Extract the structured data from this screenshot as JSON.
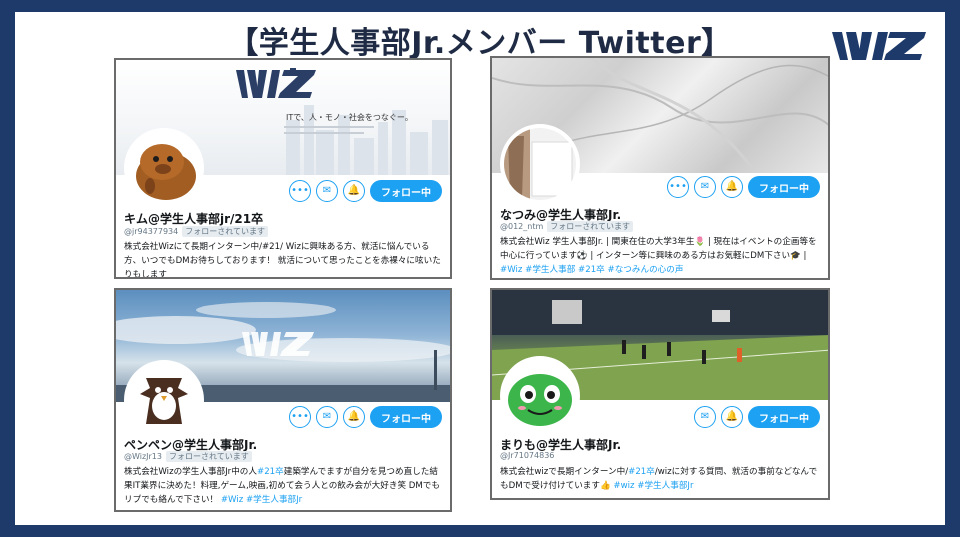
{
  "title": {
    "prefix": "【学生人事部Jr.メンバー ",
    "twitter": "Twitter",
    "suffix": "】"
  },
  "follow_label": "フォロー中",
  "follows_you_label": "フォローされています",
  "banner_tagline": "ITで、人・モノ・社会をつなぐー。",
  "cards": [
    {
      "name": "キム@学生人事部jr/21卒",
      "handle": "@jr94377934",
      "bio_1": "株式会社Wizにて長期インターン中/#21/ Wizに興味ある方、就活に悩んでいる方、いつでもDMお待ちしております！",
      "bio_2": "就活について思ったことを赤裸々に呟いたりもします"
    },
    {
      "name": "なつみ@学生人事部Jr.",
      "handle": "@012_ntm",
      "bio": "株式会社Wiz 学生人事部Jr. | 関東在住の大学3年生🌷 | 現在はイベントの企画等を中心に行っています⚽ | インターン等に興味のある方はお気軽にDM下さい🎓 |",
      "tags": "#Wiz #学生人事部 #21卒 #なつみんの心の声"
    },
    {
      "name": "ペンペン@学生人事部Jr.",
      "handle": "@WizJr13",
      "bio_1": "株式会社Wizの学生人事部Jr中の人",
      "tag_inline": "#21卒",
      "bio_2": "建築学んでますが自分を見つめ直した結果IT業界に決めた！料理,ゲーム,映画,初めて会う人との飲み会が大好き笑 DMでもリプでも絡んで下さい！",
      "tags": "#Wiz #学生人事部Jr"
    },
    {
      "name": "まりも@学生人事部Jr.",
      "handle": "@Jr71074836",
      "bio_1": "株式会社wizで長期インターン中/",
      "tag_inline": "#21卒",
      "bio_2": "/wizに対する質問、就活の事前などなんでもDMで受け付けています👍",
      "tags": "#wiz #学生人事部Jr"
    }
  ]
}
